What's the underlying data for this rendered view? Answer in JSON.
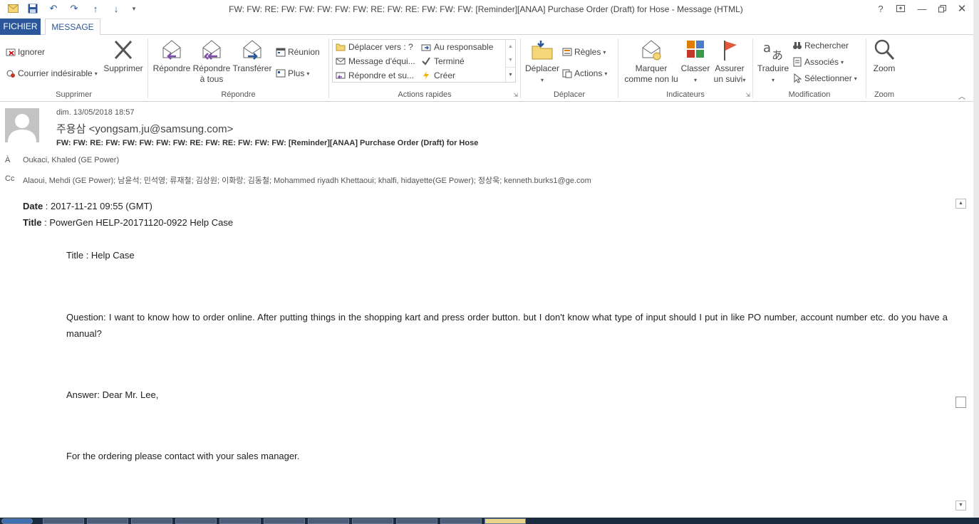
{
  "window": {
    "title": "FW: FW: RE: FW: FW: FW: FW: FW: RE: FW: RE: FW: FW: FW: [Reminder][ANAA] Purchase Order (Draft) for Hose - Message (HTML)",
    "help_label": "?"
  },
  "tabs": {
    "file": "FICHIER",
    "message": "MESSAGE"
  },
  "ribbon": {
    "supprimer": {
      "ignore": "Ignorer",
      "junk": "Courrier indésirable",
      "delete": "Supprimer",
      "label": "Supprimer"
    },
    "repondre": {
      "reply": "Répondre",
      "reply_all_1": "Répondre",
      "reply_all_2": "à tous",
      "forward": "Transférer",
      "meeting": "Réunion",
      "more": "Plus",
      "label": "Répondre"
    },
    "actions_rapides": {
      "move_to": "Déplacer vers : ?",
      "team_email": "Message d'équi...",
      "reply_delete": "Répondre et su...",
      "to_manager": "Au responsable",
      "done": "Terminé",
      "create": "Créer",
      "label": "Actions rapides"
    },
    "deplacer": {
      "move": "Déplacer",
      "rules": "Règles",
      "actions": "Actions",
      "label": "Déplacer"
    },
    "indicateurs": {
      "mark_1": "Marquer",
      "mark_2": "comme non lu",
      "classify": "Classer",
      "follow_1": "Assurer",
      "follow_2": "un suivi",
      "label": "Indicateurs"
    },
    "modification": {
      "translate": "Traduire",
      "find": "Rechercher",
      "related": "Associés",
      "select": "Sélectionner",
      "label": "Modification"
    },
    "zoom": {
      "zoom": "Zoom",
      "label": "Zoom"
    }
  },
  "message": {
    "date": "dim. 13/05/2018 18:57",
    "sender": "주용삼 <yongsam.ju@samsung.com>",
    "subject": "FW: FW: RE: FW: FW: FW: FW: FW: RE: FW: RE: FW: FW: FW: [Reminder][ANAA] Purchase Order (Draft) for Hose",
    "to_label": "À",
    "to": "Oukaci, Khaled (GE Power)",
    "cc_label": "Cc",
    "cc": "Alaoui, Mehdi (GE Power); 남윤석; 민석영; 류재철; 김상원; 이화랑; 김동철; Mohammed riyadh Khettaoui; khalfi, hidayette(GE Power); 정상욱; kenneth.burks1@ge.com"
  },
  "body": {
    "date_label": "Date",
    "date_value": " : 2017-11-21 09:55 (GMT)",
    "title_label": "Title",
    "title_value": " : PowerGen HELP-20171120-0922 Help Case",
    "title_line": "Title : Help Case",
    "question": "Question: I want to know how to order online. After putting things in the shopping kart and press order button. but I don't know what type of input should I put in like PO number, account number etc. do you have a manual?",
    "answer": "Answer: Dear Mr. Lee,",
    "ordering": "For the ordering please contact with your sales manager."
  }
}
